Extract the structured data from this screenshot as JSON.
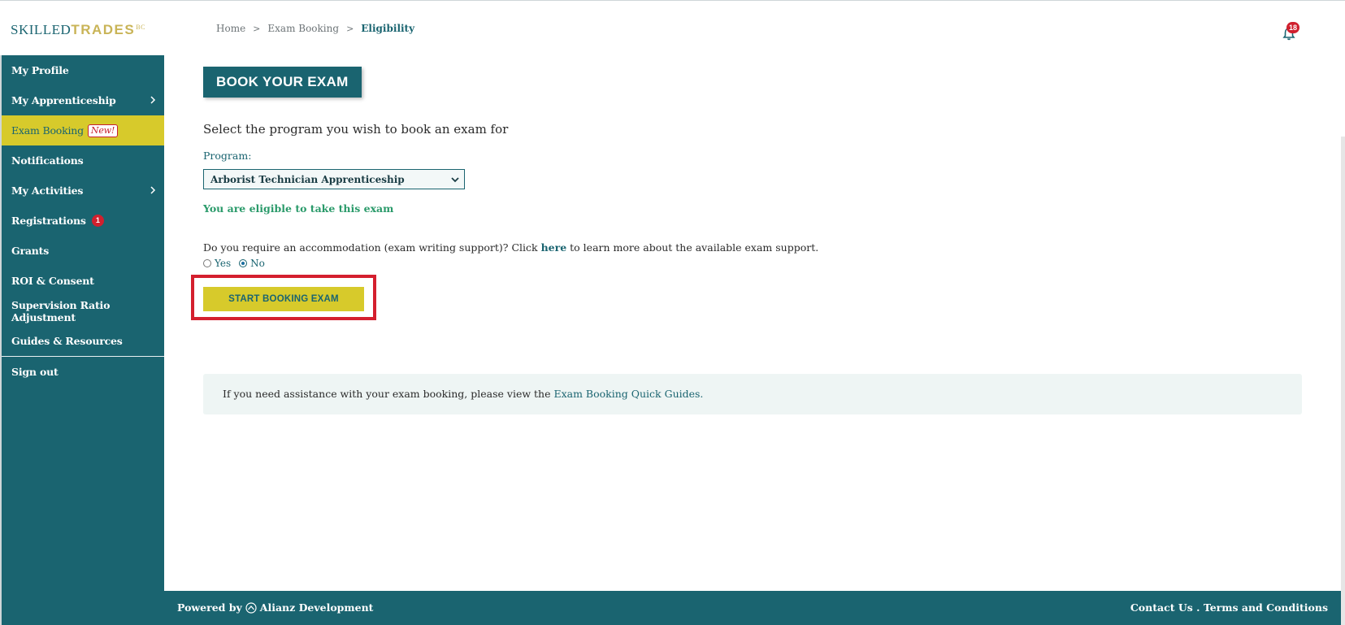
{
  "logo": {
    "part1": "SKILLED",
    "part2": "TRADES",
    "sup": "BC"
  },
  "breadcrumb": {
    "home": "Home",
    "exam_booking": "Exam Booking",
    "current": "Eligibility",
    "sep": ">"
  },
  "notifications": {
    "count": "18"
  },
  "sidebar": {
    "items": [
      {
        "label": "My Profile"
      },
      {
        "label": "My Apprenticeship"
      },
      {
        "label": "Exam Booking",
        "tag": "New!"
      },
      {
        "label": "Notifications"
      },
      {
        "label": "My Activities"
      },
      {
        "label": "Registrations",
        "badge": "1"
      },
      {
        "label": "Grants"
      },
      {
        "label": "ROI & Consent"
      },
      {
        "label": "Supervision Ratio Adjustment"
      },
      {
        "label": "Guides & Resources"
      },
      {
        "label": "Sign out"
      }
    ]
  },
  "main": {
    "title": "BOOK YOUR EXAM",
    "subtitle": "Select the program you wish to book an exam for",
    "program_label": "Program:",
    "program_selected": "Arborist Technician Apprenticeship",
    "eligible_text": "You are eligible to take this exam",
    "accom_question": "Do you require an accommodation (exam writing support)? Click ",
    "accom_link": "here",
    "accom_rest": " to learn more about the available exam support.",
    "radio_yes": "Yes",
    "radio_no": "No",
    "start_button": "START BOOKING EXAM",
    "help_text": "If you need assistance with your exam booking, please view the ",
    "help_link": "Exam Booking Quick Guides."
  },
  "footer": {
    "powered_by": "Powered by",
    "company": "Alianz Development",
    "contact": "Contact Us",
    "dot": " . ",
    "terms": "Terms and Conditions"
  },
  "colors": {
    "primary": "#1a6470",
    "accent": "#d7ca2b",
    "alert": "#d0202e",
    "success": "#2a9a6a"
  }
}
